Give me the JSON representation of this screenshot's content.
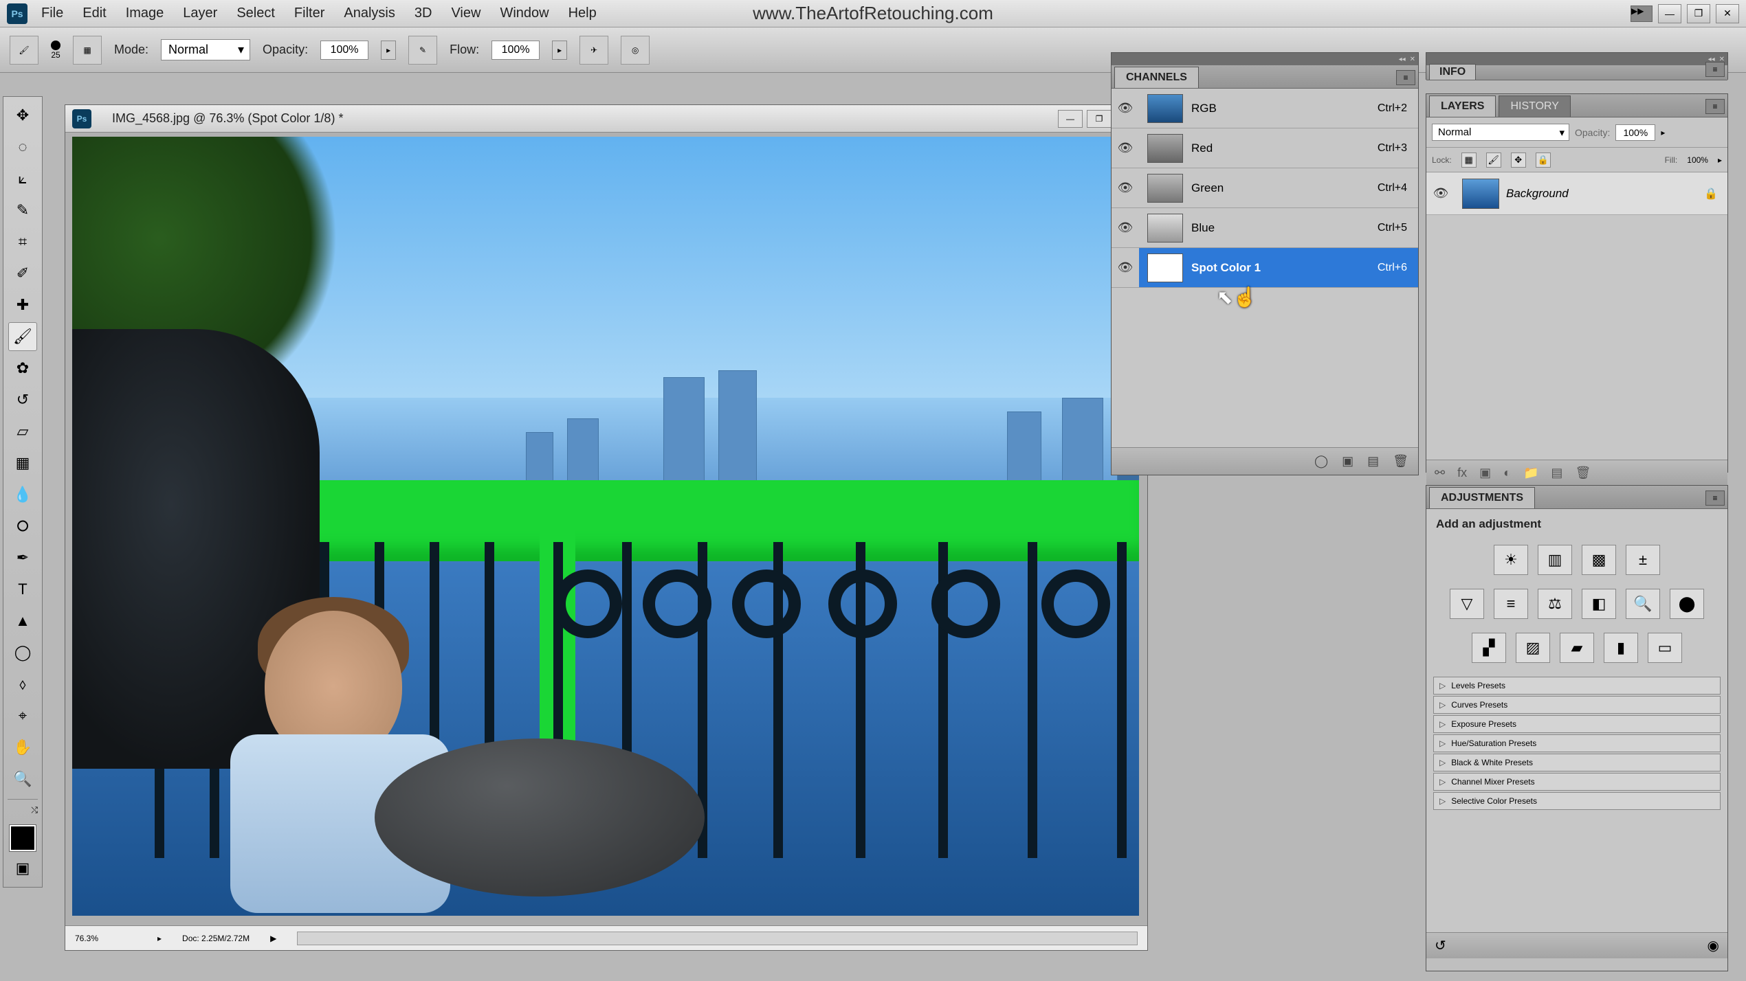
{
  "menu": {
    "file": "File",
    "edit": "Edit",
    "image": "Image",
    "layer": "Layer",
    "select": "Select",
    "filter": "Filter",
    "analysis": "Analysis",
    "threeD": "3D",
    "view": "View",
    "window": "Window",
    "help": "Help"
  },
  "brand": "www.TheArtofRetouching.com",
  "options": {
    "brush_size": "25",
    "mode_label": "Mode:",
    "mode_value": "Normal",
    "opacity_label": "Opacity:",
    "opacity_value": "100%",
    "flow_label": "Flow:",
    "flow_value": "100%"
  },
  "doc": {
    "title": "IMG_4568.jpg @ 76.3% (Spot Color 1/8) *",
    "zoom": "76.3%",
    "status": "Doc: 2.25M/2.72M"
  },
  "channels": {
    "title": "CHANNELS",
    "items": [
      {
        "name": "RGB",
        "shortcut": "Ctrl+2",
        "thumb": "rgb"
      },
      {
        "name": "Red",
        "shortcut": "Ctrl+3",
        "thumb": "r"
      },
      {
        "name": "Green",
        "shortcut": "Ctrl+4",
        "thumb": "g"
      },
      {
        "name": "Blue",
        "shortcut": "Ctrl+5",
        "thumb": "b"
      },
      {
        "name": "Spot Color 1",
        "shortcut": "Ctrl+6",
        "thumb": "spot",
        "selected": true
      }
    ]
  },
  "info": {
    "title": "INFO"
  },
  "layers": {
    "tab_layers": "LAYERS",
    "tab_history": "HISTORY",
    "blend": "Normal",
    "opacity_label": "Opacity:",
    "opacity_value": "100%",
    "lock_label": "Lock:",
    "fill_label": "Fill:",
    "fill_value": "100%",
    "items": [
      {
        "name": "Background"
      }
    ]
  },
  "adjustments": {
    "title": "ADJUSTMENTS",
    "hint": "Add an adjustment",
    "presets": [
      "Levels Presets",
      "Curves Presets",
      "Exposure Presets",
      "Hue/Saturation Presets",
      "Black & White Presets",
      "Channel Mixer Presets",
      "Selective Color Presets"
    ]
  }
}
